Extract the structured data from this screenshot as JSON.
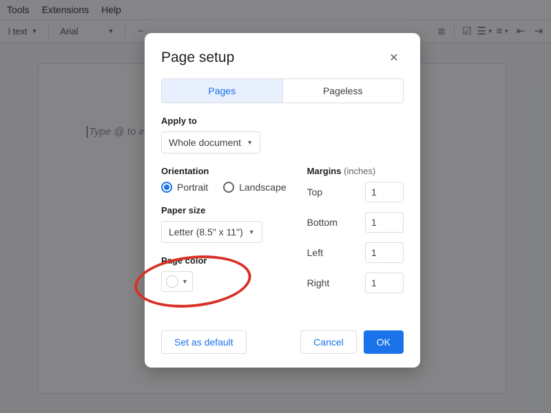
{
  "menubar": {
    "items": [
      "Tools",
      "Extensions",
      "Help"
    ]
  },
  "toolbar": {
    "style_label": "l text",
    "font_label": "Arial",
    "minus": "−"
  },
  "canvas": {
    "placeholder": "Type @ to insert"
  },
  "dialog": {
    "title": "Page setup",
    "tabs": {
      "pages": "Pages",
      "pageless": "Pageless"
    },
    "apply_to": {
      "label": "Apply to",
      "value": "Whole document"
    },
    "orientation": {
      "label": "Orientation",
      "portrait": "Portrait",
      "landscape": "Landscape"
    },
    "paper_size": {
      "label": "Paper size",
      "value": "Letter (8.5\" x 11\")"
    },
    "page_color": {
      "label": "Page color"
    },
    "margins": {
      "label": "Margins",
      "unit": "(inches)",
      "top_label": "Top",
      "top": "1",
      "bottom_label": "Bottom",
      "bottom": "1",
      "left_label": "Left",
      "left": "1",
      "right_label": "Right",
      "right": "1"
    },
    "buttons": {
      "set_default": "Set as default",
      "cancel": "Cancel",
      "ok": "OK"
    }
  }
}
